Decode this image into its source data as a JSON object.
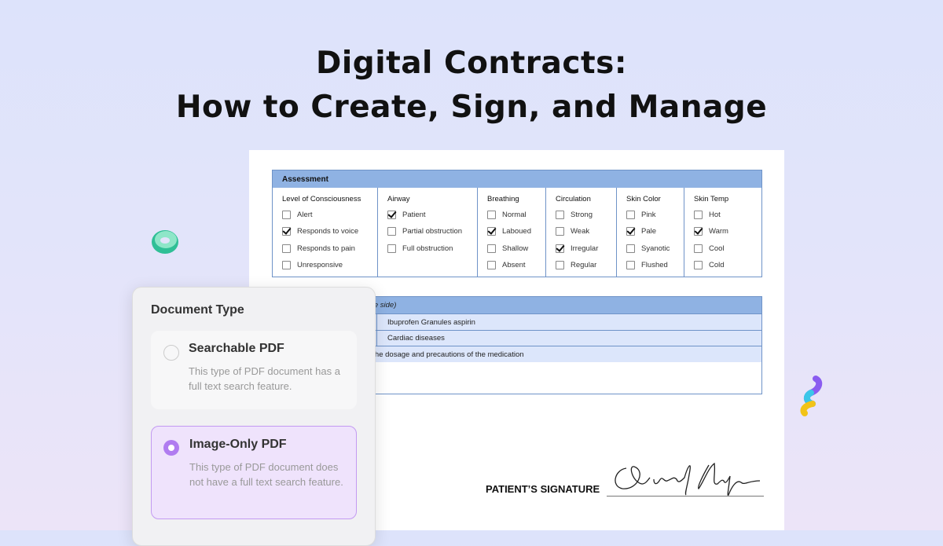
{
  "header": {
    "title_line1": "Digital Contracts:",
    "title_line2": "How to Create, Sign, and Manage"
  },
  "assessment": {
    "title": "Assessment",
    "columns": [
      {
        "heading": "Level of Consciousness",
        "items": [
          {
            "label": "Alert",
            "checked": false
          },
          {
            "label": "Responds to voice",
            "checked": true
          },
          {
            "label": "Responds to pain",
            "checked": false
          },
          {
            "label": "Unresponsive",
            "checked": false
          }
        ]
      },
      {
        "heading": "Airway",
        "items": [
          {
            "label": "Patient",
            "checked": true
          },
          {
            "label": "Partial obstruction",
            "checked": false
          },
          {
            "label": "Full obstruction",
            "checked": false
          }
        ]
      },
      {
        "heading": "Breathing",
        "items": [
          {
            "label": "Normal",
            "checked": false
          },
          {
            "label": "Laboued",
            "checked": true
          },
          {
            "label": "Shallow",
            "checked": false
          },
          {
            "label": "Absent",
            "checked": false
          }
        ]
      },
      {
        "heading": "Circulation",
        "items": [
          {
            "label": "Strong",
            "checked": false
          },
          {
            "label": "Weak",
            "checked": false
          },
          {
            "label": "Irregular",
            "checked": true
          },
          {
            "label": "Regular",
            "checked": false
          }
        ]
      },
      {
        "heading": "Skin Color",
        "items": [
          {
            "label": "Pink",
            "checked": false
          },
          {
            "label": "Pale",
            "checked": true
          },
          {
            "label": "Syanotic",
            "checked": false
          },
          {
            "label": "Flushed",
            "checked": false
          }
        ]
      },
      {
        "heading": "Skin Temp",
        "items": [
          {
            "label": "Hot",
            "checked": false
          },
          {
            "label": "Warm",
            "checked": true
          },
          {
            "label": "Cool",
            "checked": false
          },
          {
            "label": "Cold",
            "checked": false
          }
        ]
      }
    ]
  },
  "medication": {
    "header": "tion maybe recorded on reverse side)",
    "row1": "Ibuprofen Granules  aspirin",
    "row2": "Cardiac diseases",
    "row3": "se ask the doctor to help note the dosage and precautions of the medication"
  },
  "signature": {
    "label": "PATIENT’S SIGNATURE"
  },
  "panel": {
    "title": "Document Type",
    "options": [
      {
        "label": "Searchable PDF",
        "description": "This type of PDF document has a full text search feature.",
        "selected": false
      },
      {
        "label": "Image-Only PDF",
        "description": "This type of PDF document does not have a full text search feature.",
        "selected": true
      }
    ]
  },
  "colors": {
    "accent": "#b07cf0",
    "table_header": "#8fb2e3",
    "table_row": "#dce6fb"
  }
}
